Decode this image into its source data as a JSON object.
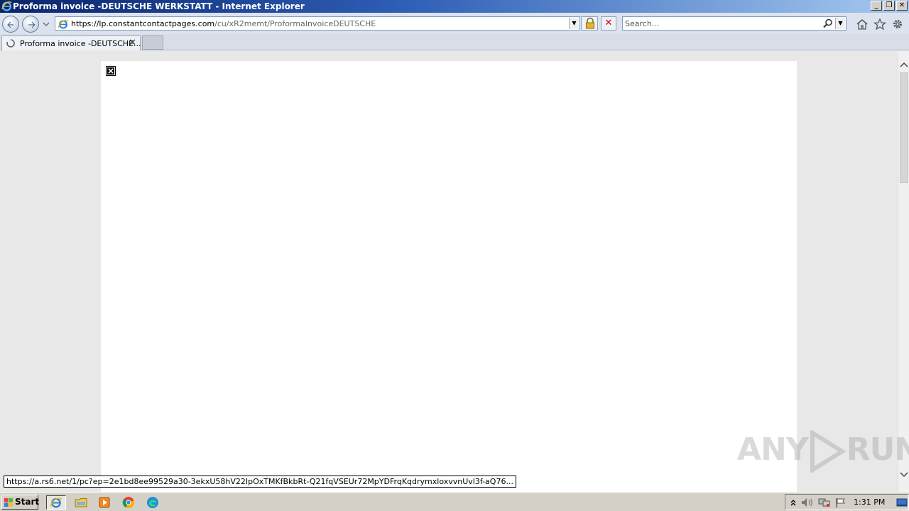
{
  "window": {
    "title": "Proforma invoice -DEUTSCHE WERKSTATT - Internet Explorer",
    "controls": {
      "minimize": "_",
      "restore": "❐",
      "close": "✕"
    }
  },
  "navbar": {
    "url_host": "https://lp.constantcontactpages.com",
    "url_path": "/cu/xR2memt/ProformaInvoiceDEUTSCHE",
    "search_placeholder": "Search...",
    "stop_symbol": "✕"
  },
  "tabs": [
    {
      "label": "Proforma invoice -DEUTSCHE...",
      "close": "✕",
      "loading": true
    }
  ],
  "status": {
    "hover_url": "https://a.rs6.net/1/pc?ep=2e1bd8ee99529a30-3ekxU58hV22IpOxTMKfBkbRt-Q21fqVSEUr72MpYDFrqKqdrymxloxvvnUvl3f-aQ76..."
  },
  "watermark": {
    "text_left": "ANY",
    "text_right": "RUN"
  },
  "taskbar": {
    "start_label": "Start",
    "clock": "1:31 PM"
  },
  "colors": {
    "titlebar_start": "#0a246a",
    "titlebar_end": "#a6caf0",
    "taskbar": "#d4d0c8",
    "page_bg": "#ffffff",
    "viewport_bg": "#e8e8e8"
  }
}
